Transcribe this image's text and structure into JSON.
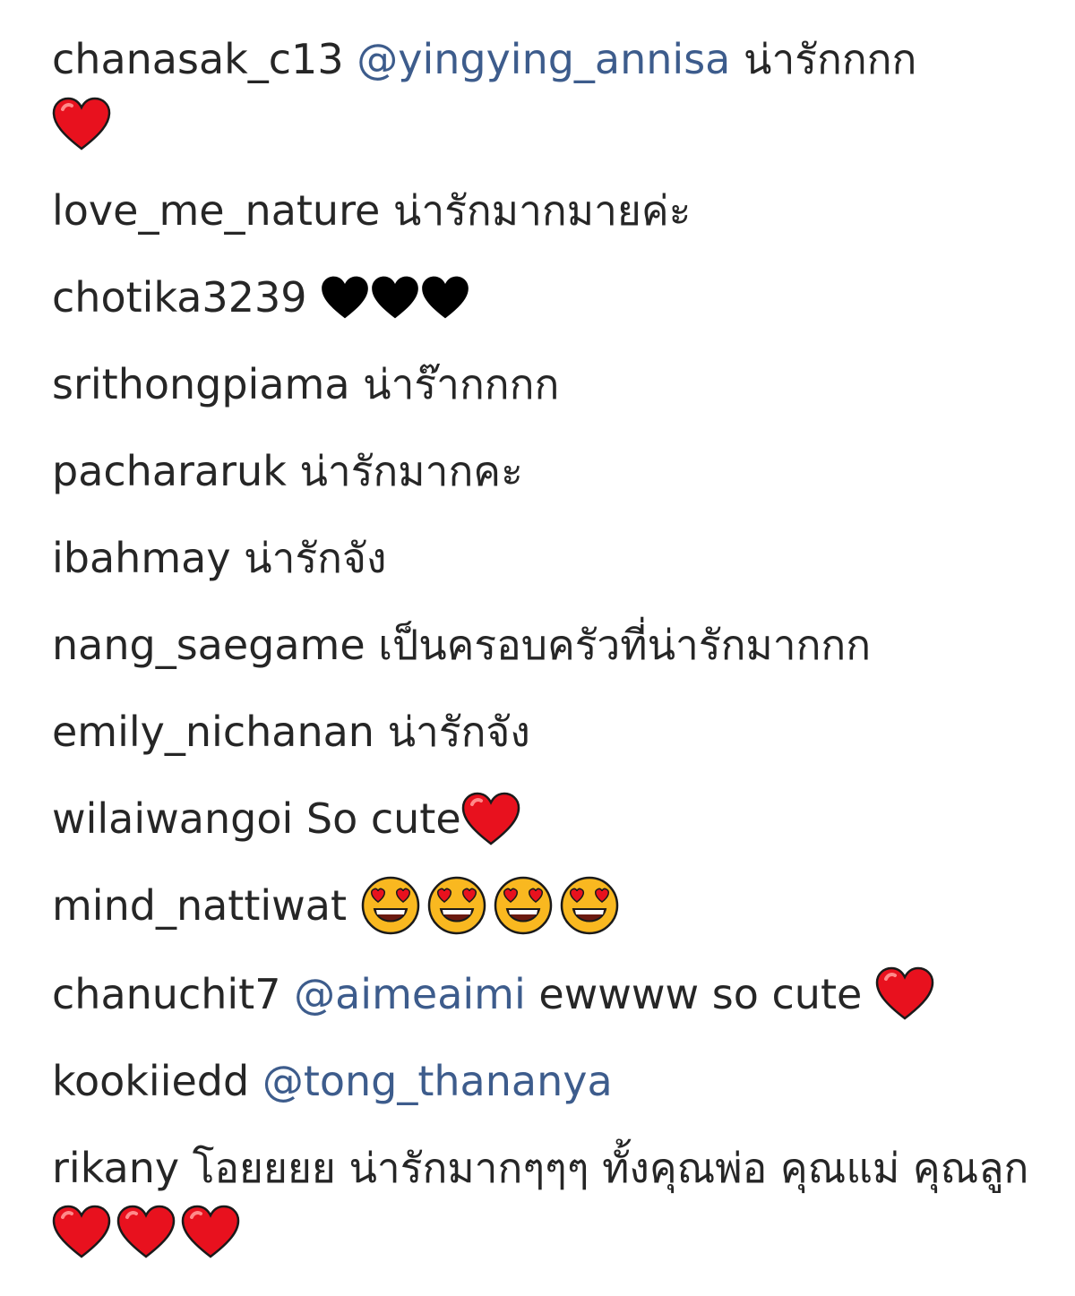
{
  "colors": {
    "text": "#262626",
    "mention": "#3d5c8c",
    "heart_red": "#e8111e",
    "heart_black": "#000000",
    "emoji_face": "#f9b820"
  },
  "comments": [
    {
      "user": "chanasak_c13",
      "mention": "@yingying_annisa",
      "text": "น่ารักกกก",
      "emojis": [
        "red-heart"
      ]
    },
    {
      "user": "love_me_nature",
      "text": "น่ารักมากมายค่ะ"
    },
    {
      "user": "chotika3239",
      "emojis": [
        "black-heart",
        "black-heart",
        "black-heart"
      ]
    },
    {
      "user": "srithongpiama",
      "text": "น่าร๊ากกกก"
    },
    {
      "user": "pachararuk",
      "text": "น่ารักมากคะ"
    },
    {
      "user": "ibahmay",
      "text": "น่ารักจัง"
    },
    {
      "user": "nang_saegame",
      "text": "เป็นครอบครัวที่น่ารักมากกก"
    },
    {
      "user": "emily_nichanan",
      "text": "น่ารักจัง"
    },
    {
      "user": "wilaiwangoi",
      "text": "So cute",
      "emojis": [
        "red-heart"
      ]
    },
    {
      "user": "mind_nattiwat",
      "emojis": [
        "heart-eyes-face",
        "heart-eyes-face",
        "heart-eyes-face",
        "heart-eyes-face"
      ]
    },
    {
      "user": "chanuchit7",
      "mention": "@aimeaimi",
      "text": "ewwww so cute",
      "emojis": [
        "red-heart"
      ]
    },
    {
      "user": "kookiiedd",
      "mention": "@tong_thananya"
    },
    {
      "user": "rikany",
      "text": "โอยยยย น่ารักมากๆๆๆ ทั้งคุณพ่อ คุณแม่ คุณลูก",
      "emojis": [
        "red-heart",
        "red-heart",
        "red-heart"
      ]
    }
  ]
}
